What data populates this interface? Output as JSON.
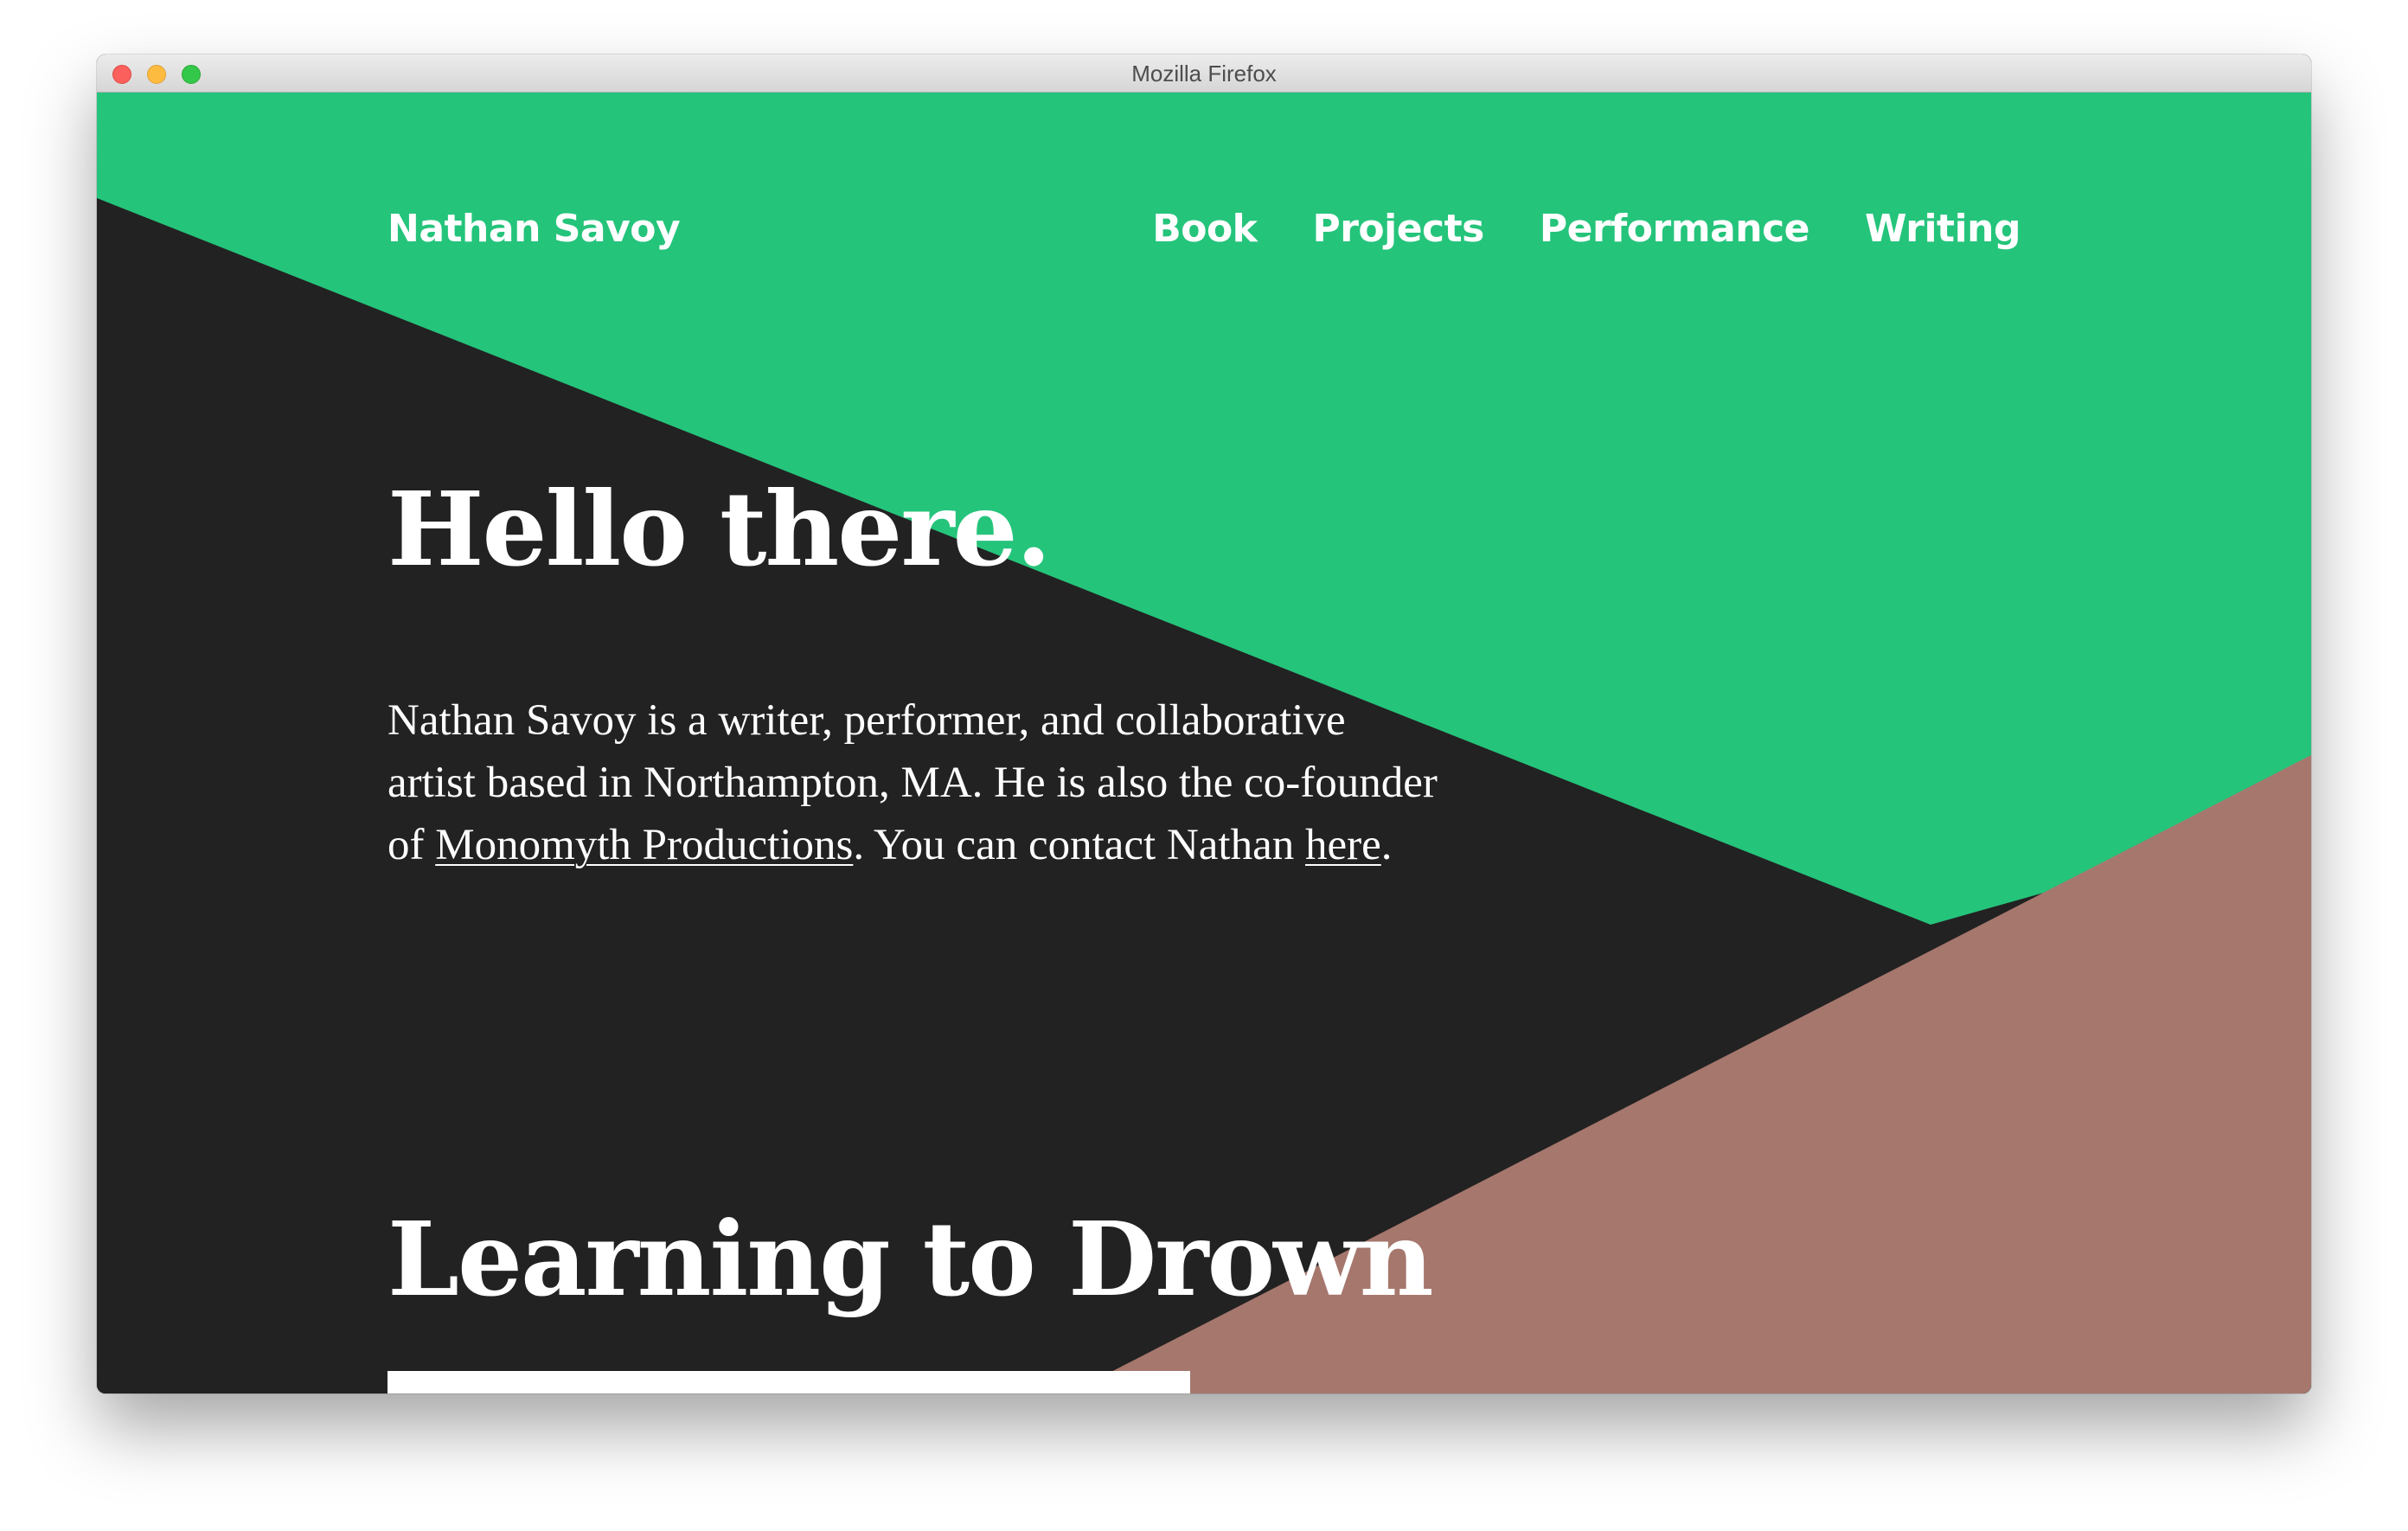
{
  "window": {
    "title": "Mozilla Firefox"
  },
  "header": {
    "brand": "Nathan Savoy",
    "nav": [
      {
        "label": "Book"
      },
      {
        "label": "Projects"
      },
      {
        "label": "Performance"
      },
      {
        "label": "Writing"
      }
    ]
  },
  "hero": {
    "title": "Hello there.",
    "intro": {
      "text_1": "Nathan Savoy is a writer, performer, and collaborative artist based in Northampton, MA. He is also the co-founder of ",
      "link_1": "Monomyth Productions",
      "text_2": ". You can contact Nathan ",
      "link_2": "here",
      "text_3": "."
    }
  },
  "book_section": {
    "title": "Learning to Drown"
  },
  "colors": {
    "green": "#25c47b",
    "dark": "#222222",
    "rose": "#a6776d",
    "text": "#ffffff"
  }
}
